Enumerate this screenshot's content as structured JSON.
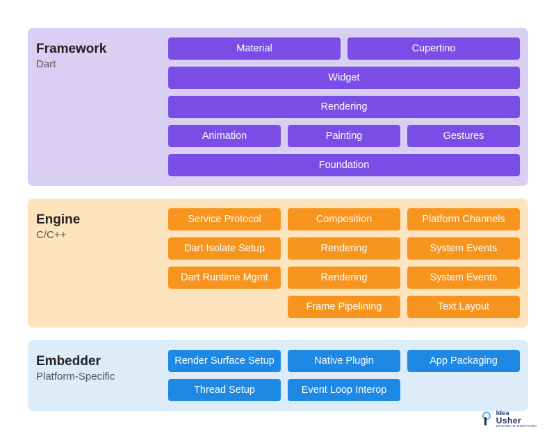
{
  "layers": [
    {
      "id": "framework",
      "title": "Framework",
      "subtitle": "Dart",
      "rows": [
        [
          "Material",
          "Cupertino"
        ],
        [
          "Widget"
        ],
        [
          "Rendering"
        ],
        [
          "Animation",
          "Painting",
          "Gestures"
        ],
        [
          "Foundation"
        ]
      ]
    },
    {
      "id": "engine",
      "title": "Engine",
      "subtitle": "C/C++",
      "rows": [
        [
          "Service Protocol",
          "Composition",
          "Platform Channels"
        ],
        [
          "Dart Isolate Setup",
          "Rendering",
          "System Events"
        ],
        [
          "Dart Runtime Mgmt",
          "Rendering",
          "System Events"
        ],
        [
          null,
          "Frame Pipelining",
          "Text Layout"
        ]
      ]
    },
    {
      "id": "embedder",
      "title": "Embedder",
      "subtitle": "Platform-Specific",
      "rows": [
        [
          "Render Surface Setup",
          "Native Plugin",
          "App Packaging"
        ],
        [
          "Thread Setup",
          "Event Loop Interop",
          null
        ]
      ]
    }
  ],
  "watermark": {
    "line1": "Idea",
    "line2": "Usher",
    "tagline": "LEADING IN INNOVATION"
  }
}
